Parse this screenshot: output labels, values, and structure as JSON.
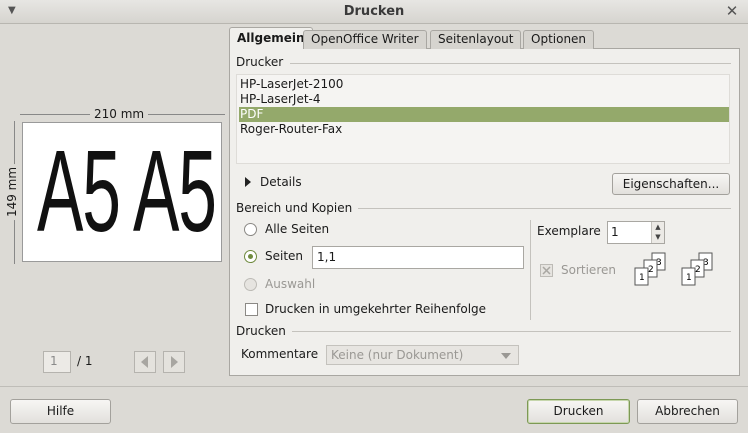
{
  "window": {
    "title": "Drucken"
  },
  "preview": {
    "width_label": "210 mm",
    "height_label": "149 mm",
    "page_text_left": "A5",
    "page_text_right": "A5",
    "current_page": "1",
    "total_pages": "/ 1"
  },
  "tabs": [
    {
      "label": "Allgemein",
      "active": true
    },
    {
      "label": "OpenOffice Writer",
      "active": false
    },
    {
      "label": "Seitenlayout",
      "active": false
    },
    {
      "label": "Optionen",
      "active": false
    }
  ],
  "printer_section": {
    "title": "Drucker",
    "printers": [
      "HP-LaserJet-2100",
      "HP-LaserJet-4",
      "PDF",
      "Roger-Router-Fax"
    ],
    "selected": "PDF",
    "details_label": "Details",
    "properties_button": "Eigenschaften..."
  },
  "range_section": {
    "title": "Bereich und Kopien",
    "all_pages": "Alle Seiten",
    "pages": "Seiten",
    "pages_value": "1,1",
    "selection": "Auswahl",
    "reverse_order": "Drucken in umgekehrter Reihenfolge",
    "copies_label": "Exemplare",
    "copies_value": "1",
    "collate_label": "Sortieren"
  },
  "print_section": {
    "title": "Drucken",
    "comments_label": "Kommentare",
    "comments_value": "Keine (nur Dokument)"
  },
  "footer": {
    "help": "Hilfe",
    "print": "Drucken",
    "cancel": "Abbrechen"
  },
  "colors": {
    "selection_green": "#94a96b",
    "dialog_bg": "#dcdad5"
  }
}
